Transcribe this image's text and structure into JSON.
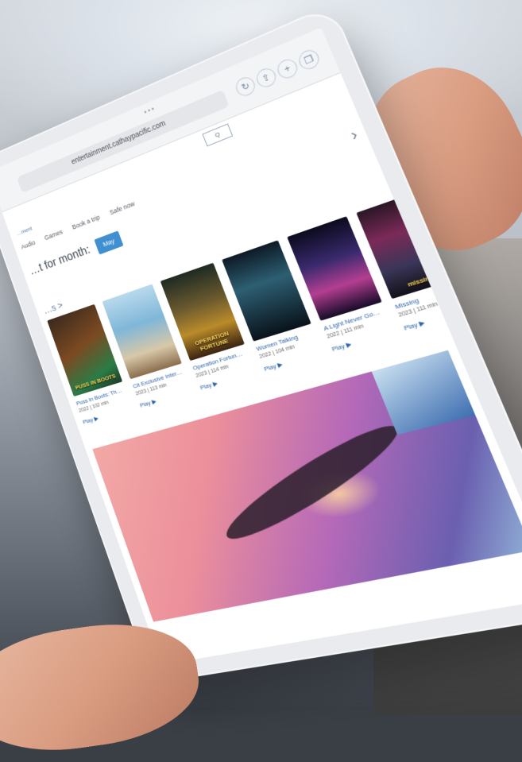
{
  "browser": {
    "url": "entertainment.cathaypacific.com",
    "search_label": "Q",
    "icons": [
      "refresh-icon",
      "share-icon",
      "new-tab-icon",
      "tabs-icon"
    ]
  },
  "site": {
    "label": "…ment",
    "nav": [
      "Audio",
      "Games",
      "Book a trip",
      "Safe now"
    ],
    "month_title": "…t for month:",
    "month_pill": "May",
    "section_link": "…s >",
    "next_arrow": "›"
  },
  "posters": [
    {
      "title": "Puss in Boots: Th…",
      "meta": "2022 | 102 min",
      "play": "Play ▶",
      "art_caption": "PUSS IN BOOTS"
    },
    {
      "title": "Cit Exclusive Inter…",
      "meta": "2023 | 113 min",
      "play": "Play ▶",
      "art_caption": ""
    },
    {
      "title": "Operation Fortun…",
      "meta": "2023 | 114 min",
      "play": "Play ▶",
      "art_caption": "OPERATION FORTUNE"
    },
    {
      "title": "Women Talking",
      "meta": "2022 | 104 min",
      "play": "Play ▶",
      "art_caption": ""
    },
    {
      "title": "A Light Never Go…",
      "meta": "2022 | 111 min",
      "play": "Play ▶",
      "art_caption": ""
    },
    {
      "title": "Missing",
      "meta": "2023 | 111 min",
      "play": "Play ▶",
      "art_caption": "missing"
    }
  ],
  "colors": {
    "accent_blue": "#3f8fd1",
    "link_blue": "#2c62a6"
  }
}
